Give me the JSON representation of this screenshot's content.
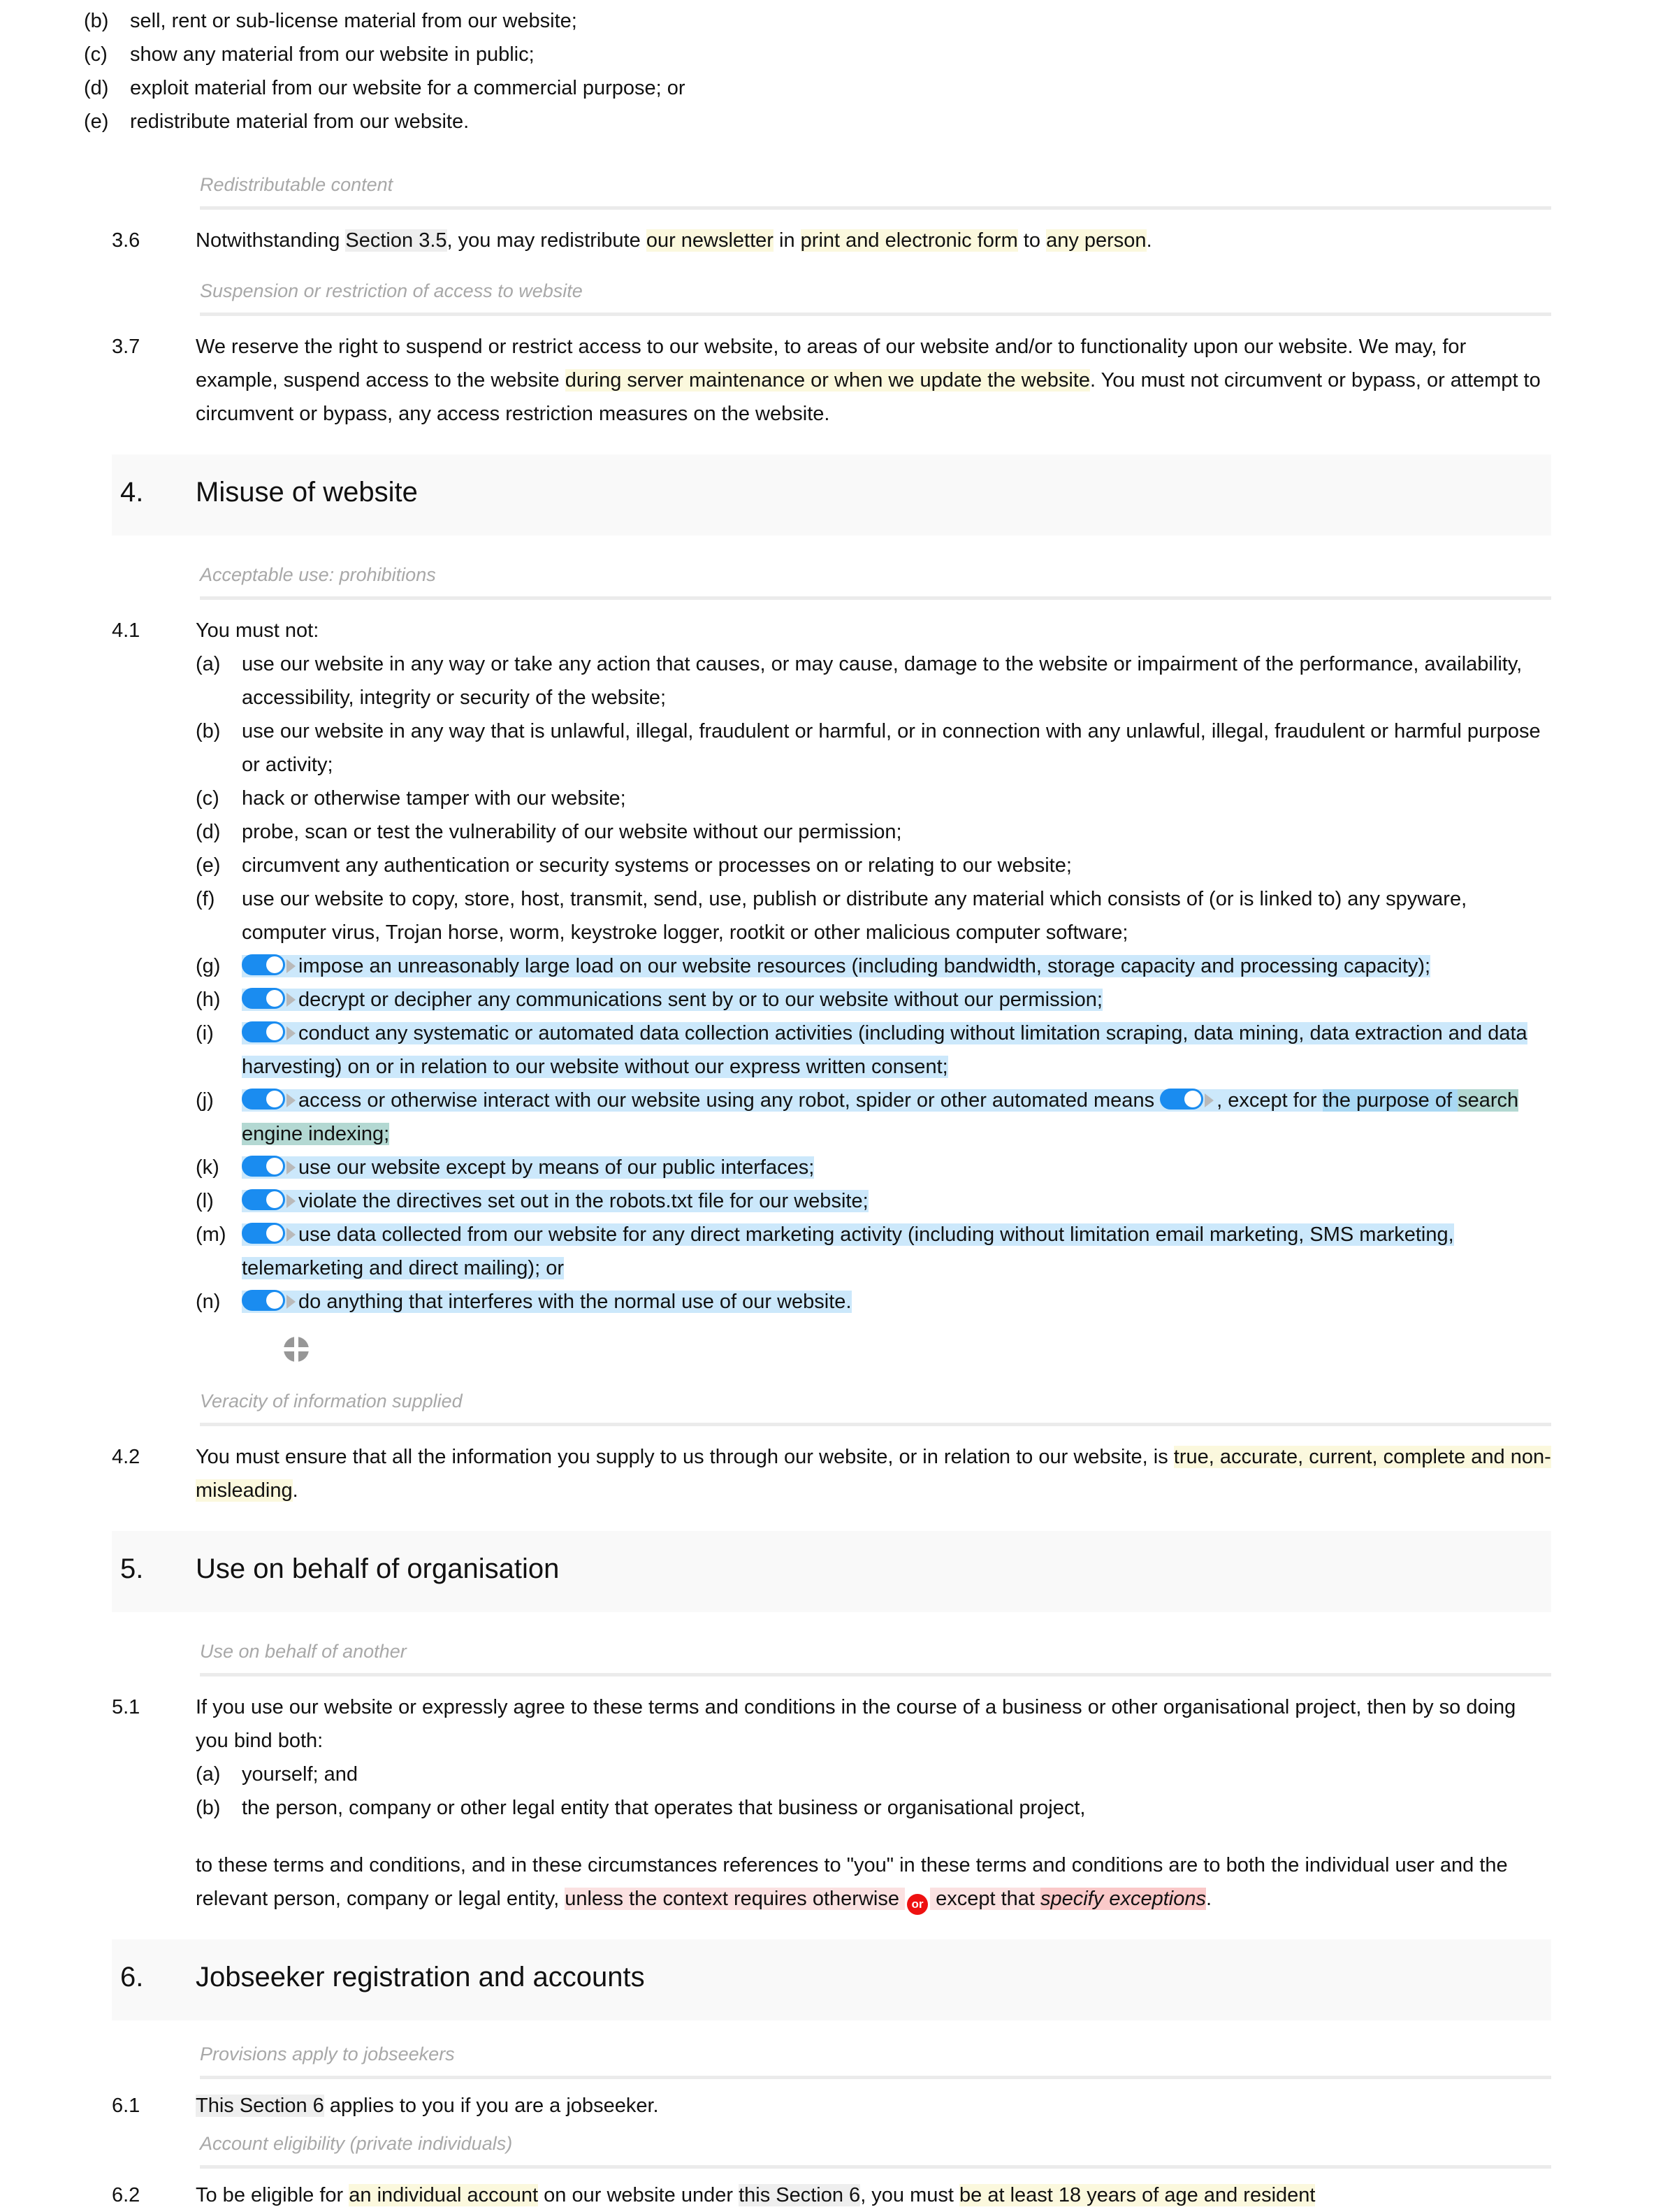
{
  "doc": {
    "list_3_5": [
      {
        "label": "(b)",
        "text": "sell, rent or sub-license material from our website;"
      },
      {
        "label": "(c)",
        "text": "show any material from our website in public;"
      },
      {
        "label": "(d)",
        "text": "exploit material from our website for a commercial purpose; or"
      },
      {
        "label": "(e)",
        "text": "redistribute material from our website."
      }
    ],
    "guide_redistributable": "Redistributable content",
    "clause_3_6": {
      "number": "3.6",
      "t1": "Notwithstanding ",
      "ref": "Section 3.5",
      "t2": ", you may redistribute ",
      "hl1": "our newsletter",
      "t3": " in ",
      "hl2": "print and electronic form",
      "t4": " to ",
      "hl3": "any person",
      "t5": "."
    },
    "guide_suspension": "Suspension or restriction of access to website",
    "clause_3_7": {
      "number": "3.7",
      "t1": "We reserve the right to suspend or restrict access to our website, to areas of our website and/or to functionality upon our website. We may, for example, suspend access to the website ",
      "hl1": "during server maintenance or when we update the website",
      "t2": ". You must not circumvent or bypass, or attempt to circumvent or bypass, any access restriction measures on the website."
    },
    "section_4": {
      "number": "4.",
      "title": "Misuse of website"
    },
    "guide_acceptable_use": "Acceptable use: prohibitions",
    "clause_4_1": {
      "number": "4.1",
      "lead": "You must not:",
      "items": [
        {
          "label": "(a)",
          "text": "use our website in any way or take any action that causes, or may cause, damage to the website or impairment of the performance, availability, accessibility, integrity or security of the website;",
          "toggle": false,
          "highlight": false
        },
        {
          "label": "(b)",
          "text": "use our website in any way that is unlawful, illegal, fraudulent or harmful, or in connection with any unlawful, illegal, fraudulent or harmful purpose or activity;",
          "toggle": false,
          "highlight": false
        },
        {
          "label": "(c)",
          "text": "hack or otherwise tamper with our website;",
          "toggle": false,
          "highlight": false
        },
        {
          "label": "(d)",
          "text": "probe, scan or test the vulnerability of our website without our permission;",
          "toggle": false,
          "highlight": false
        },
        {
          "label": "(e)",
          "text": "circumvent any authentication or security systems or processes on or relating to our website;",
          "toggle": false,
          "highlight": false
        },
        {
          "label": "(f)",
          "text": "use our website to copy, store, host, transmit, send, use, publish or distribute any material which consists of (or is linked to) any spyware, computer virus, Trojan horse, worm, keystroke logger, rootkit or other malicious computer software;",
          "toggle": false,
          "highlight": false
        },
        {
          "label": "(g)",
          "text": "impose an unreasonably large load on our website resources (including bandwidth, storage capacity and processing capacity);",
          "toggle": true,
          "highlight": true
        },
        {
          "label": "(h)",
          "text": "decrypt or decipher any communications sent by or to our website without our permission;",
          "toggle": true,
          "highlight": true
        },
        {
          "label": "(i)",
          "text": "conduct any systematic or automated data collection activities (including without limitation scraping, data mining, data extraction and data harvesting) on or in relation to our website without our express written consent;",
          "toggle": true,
          "highlight": true
        },
        {
          "label": "(k)",
          "text": "use our website except by means of our public interfaces;",
          "toggle": true,
          "highlight": true
        },
        {
          "label": "(l)",
          "text": "violate the directives set out in the robots.txt file for our website;",
          "toggle": true,
          "highlight": true
        },
        {
          "label": "(m)",
          "text": "use data collected from our website for any direct marketing activity (including without limitation email marketing, SMS marketing, telemarketing and direct mailing); or",
          "toggle": true,
          "highlight": true
        },
        {
          "label": "(n)",
          "text": "do anything that interferes with the normal use of our website.",
          "toggle": true,
          "highlight": true
        }
      ],
      "item_j": {
        "label": "(j)",
        "part1": "access or otherwise interact with our website using any robot, spider or other automated means ",
        "part2": ", except for ",
        "part3": "the purpose of ",
        "part4": "search engine indexing;"
      }
    },
    "guide_veracity": "Veracity of information supplied",
    "clause_4_2": {
      "number": "4.2",
      "t1": "You must ensure that all the information you supply to us through our website, or in relation to our website, is ",
      "hl1": "true, accurate, current, complete and non-misleading",
      "t2": "."
    },
    "section_5": {
      "number": "5.",
      "title": "Use on behalf of organisation"
    },
    "guide_behalf": "Use on behalf of another",
    "clause_5_1": {
      "number": "5.1",
      "lead": "If you use our website or expressly agree to these terms and conditions in the course of a business or other organisational project, then by so doing you bind both:",
      "items": [
        {
          "label": "(a)",
          "text": "yourself; and"
        },
        {
          "label": "(b)",
          "text": "the person, company or other legal entity that operates that business or organisational project,"
        }
      ],
      "tail_t1": "to these terms and conditions, and in these circumstances references to \"you\" in these terms and conditions are to both the individual user and the relevant person, company or legal entity, ",
      "tail_hl1": "unless the context requires otherwise ",
      "tail_or": "or",
      "tail_hl2": " except that ",
      "tail_hl3": "specify exceptions",
      "tail_t2": "."
    },
    "section_6": {
      "number": "6.",
      "title": "Jobseeker registration and accounts"
    },
    "guide_jobseekers": "Provisions apply to jobseekers",
    "clause_6_1": {
      "number": "6.1",
      "ref": "This Section 6",
      "t1": " applies to you if you are a jobseeker."
    },
    "guide_account_eligibility": "Account eligibility (private individuals)",
    "clause_6_2": {
      "number": "6.2",
      "t1": "To be eligible for ",
      "hl1": "an individual account",
      "t2": " on our website under ",
      "ref": "this Section 6",
      "t3": ", you must ",
      "hl2": "be at least 18 years of age and resident"
    }
  },
  "icons": {
    "toggle_on": "toggle-on-icon",
    "toggle_arrow": "toggle-arrow-icon",
    "crosshair": "crosshair-circle-icon",
    "or_badge": "or-conjunction-badge"
  },
  "colors": {
    "toggle_on": "#1a8cf0",
    "highlight_blue": "#cce8fb",
    "highlight_yellow": "#fbf8dd",
    "highlight_gray": "#eeeeee",
    "highlight_pink": "#fbe1e1",
    "highlight_teal": "#b3d8d2",
    "or_badge_red": "#ee1111",
    "guide_text": "#a8a8a8",
    "section_band": "#f9f9f9"
  }
}
